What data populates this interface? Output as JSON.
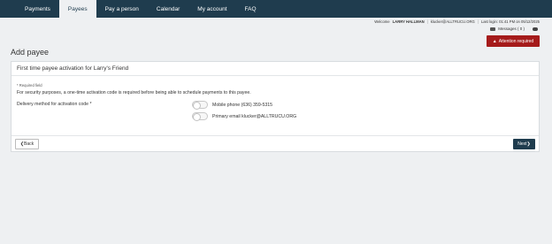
{
  "nav": {
    "items": [
      {
        "label": "Payments"
      },
      {
        "label": "Payees"
      },
      {
        "label": "Pay a person"
      },
      {
        "label": "Calendar"
      },
      {
        "label": "My account"
      },
      {
        "label": "FAQ"
      }
    ],
    "active_index": 1
  },
  "header": {
    "welcome_prefix": "Welcome",
    "user_name": "LARRY HALLMAN",
    "email": "klucker@ALLTRUCU.ORG",
    "last_login": "Last login: 01:41 PM on 05/12/2025",
    "messages_label": "Messages ( 0 )",
    "attention_label": "Attention required"
  },
  "page": {
    "title": "Add payee"
  },
  "card": {
    "title": "First time payee activation for Larry's Friend",
    "required_note": "* Required field",
    "security_text": "For security purposes, a one-time activation code is required before being able to schedule payments to this payee.",
    "delivery_label": "Delivery method for activation code *",
    "options": [
      {
        "label": "Mobile phone (636) 359-5315"
      },
      {
        "label": "Primary email klucker@ALLTRUCU.ORG"
      }
    ],
    "back_label": "Back",
    "next_label": "Next"
  },
  "colors": {
    "navbar": "#1f3c4e",
    "attention": "#a51b1b",
    "next_button": "#1f3c4e"
  }
}
